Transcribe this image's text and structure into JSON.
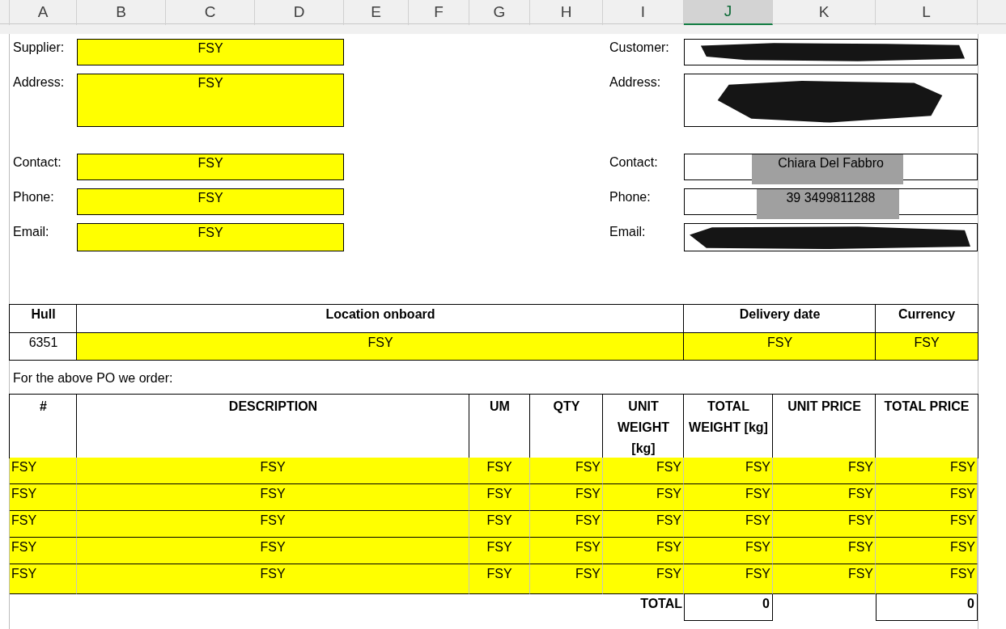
{
  "column_headers": [
    {
      "label": "A",
      "selected": false
    },
    {
      "label": "B",
      "selected": false
    },
    {
      "label": "C",
      "selected": false
    },
    {
      "label": "D",
      "selected": false
    },
    {
      "label": "E",
      "selected": false
    },
    {
      "label": "F",
      "selected": false
    },
    {
      "label": "G",
      "selected": false
    },
    {
      "label": "H",
      "selected": false
    },
    {
      "label": "I",
      "selected": false
    },
    {
      "label": "J",
      "selected": true
    },
    {
      "label": "K",
      "selected": false
    },
    {
      "label": "L",
      "selected": false
    }
  ],
  "supplier_fields": [
    {
      "label": "Supplier:",
      "value": "FSY",
      "highlighted": true
    },
    {
      "label": "Address:",
      "value": "FSY",
      "highlighted": true
    },
    {
      "label": "Contact:",
      "value": "FSY",
      "highlighted": true
    },
    {
      "label": "Phone:",
      "value": "FSY",
      "highlighted": true
    },
    {
      "label": "Email:",
      "value": "FSY",
      "highlighted": true
    }
  ],
  "customer_fields": [
    {
      "label": "Customer:",
      "blacked_out": true,
      "shaded": false
    },
    {
      "label": "Address:",
      "blacked_out": true,
      "shaded": false
    },
    {
      "label": "Contact:",
      "value": "Chiara Del Fabbro",
      "blacked_out": false,
      "shaded": true
    },
    {
      "label": "Phone:",
      "value": "39 3499811288",
      "blacked_out": false,
      "shaded": true
    },
    {
      "label": "Email:",
      "blacked_out": true,
      "shaded": false
    }
  ],
  "hull_table": {
    "columns": [
      "Hull",
      "Location onboard",
      "Delivery date",
      "Currency"
    ],
    "row": [
      {
        "text": "6351",
        "highlighted": false
      },
      {
        "text": "FSY",
        "highlighted": true
      },
      {
        "text": "FSY",
        "highlighted": true
      },
      {
        "text": "FSY",
        "highlighted": true
      }
    ]
  },
  "order_note": "For the above PO we order:",
  "items_table": {
    "columns": [
      "#",
      "DESCRIPTION",
      "UM",
      "QTY",
      "UNIT WEIGHT [kg]",
      "TOTAL WEIGHT [kg]",
      "UNIT PRICE",
      "TOTAL PRICE"
    ],
    "rows": [
      {
        "highlighted": true,
        "cells": [
          "FSY",
          "FSY",
          "FSY",
          "FSY",
          "FSY",
          "FSY",
          "FSY",
          "FSY"
        ]
      },
      {
        "highlighted": true,
        "cells": [
          "FSY",
          "FSY",
          "FSY",
          "FSY",
          "FSY",
          "FSY",
          "FSY",
          "FSY"
        ]
      },
      {
        "highlighted": true,
        "cells": [
          "FSY",
          "FSY",
          "FSY",
          "FSY",
          "FSY",
          "FSY",
          "FSY",
          "FSY"
        ]
      },
      {
        "highlighted": true,
        "cells": [
          "FSY",
          "FSY",
          "FSY",
          "FSY",
          "FSY",
          "FSY",
          "FSY",
          "FSY"
        ]
      },
      {
        "highlighted": true,
        "cells": [
          "FSY",
          "FSY",
          "FSY",
          "FSY",
          "FSY",
          "FSY",
          "FSY",
          "FSY"
        ]
      }
    ],
    "total_label": "TOTAL",
    "total_weight": "0",
    "total_price": "0"
  }
}
